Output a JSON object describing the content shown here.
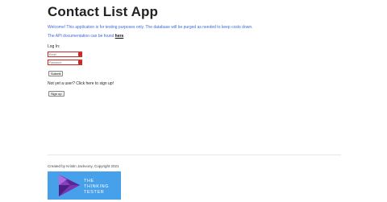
{
  "app": {
    "title": "Contact List App"
  },
  "notice": {
    "welcome": "Welcome! This application is for testing purposes only. The database will be purged as needed to keep costs down.",
    "api_prefix": "The API documentation can be found ",
    "api_link": "here",
    "api_suffix": "."
  },
  "login": {
    "label": "Log In:",
    "email_placeholder": "Email",
    "password_placeholder": "Password",
    "submit_label": "Submit"
  },
  "signup": {
    "prompt": "Not yet a user? Click here to sign up!",
    "button_label": "Sign up"
  },
  "footer": {
    "credit": "Created by Kristin Jackvony, Copyright 2021",
    "logo_lines": [
      "THE",
      "THINKING",
      "TESTER"
    ]
  },
  "colors": {
    "accent_text": "#3b6ad9",
    "error_badge": "#c62828",
    "logo_background": "#46a0ea",
    "logo_mark_purple": "#6a2ea0"
  }
}
